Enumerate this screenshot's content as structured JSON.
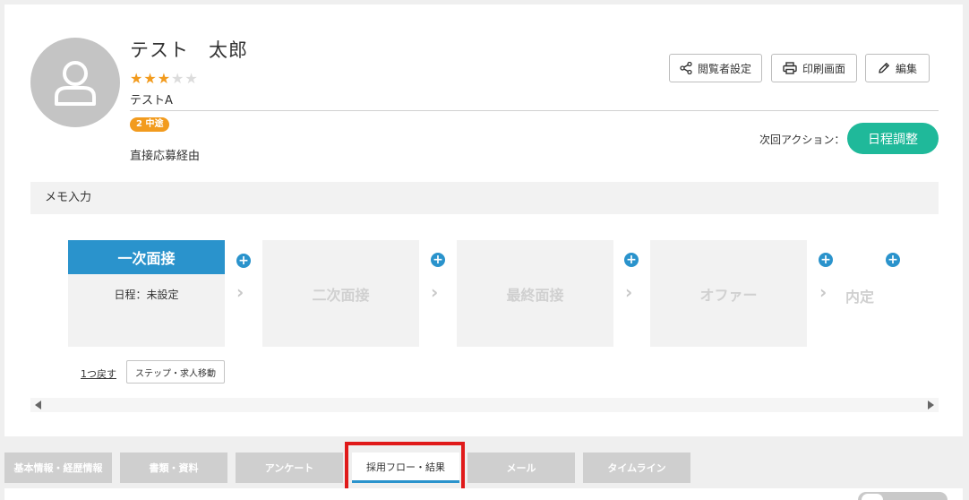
{
  "profile": {
    "name": "テスト　太郎",
    "rating": 3,
    "rating_max": 5,
    "subtitle": "テストA",
    "badge": "2 中途",
    "route": "直接応募経由"
  },
  "header_buttons": {
    "viewer_settings": "閲覧者設定",
    "print": "印刷画面",
    "edit": "編集"
  },
  "next_action": {
    "label": "次回アクション：",
    "button": "日程調整",
    "color": "#1fb99a"
  },
  "memo": {
    "placeholder": "メモ入力"
  },
  "flow": {
    "active_step": {
      "title": "一次面接",
      "schedule": "日程：未設定"
    },
    "steps": [
      "二次面接",
      "最終面接",
      "オファー"
    ],
    "last_step": "内定",
    "back_link": "1つ戻す",
    "move_button": "ステップ・求人移動"
  },
  "tabs": [
    {
      "label": "基本情報・経歴情報"
    },
    {
      "label": "書類・資料"
    },
    {
      "label": "アンケート"
    },
    {
      "label": "採用フロー・結果",
      "active": true
    },
    {
      "label": "メール"
    },
    {
      "label": "タイムライン"
    }
  ],
  "colors": {
    "accent_blue": "#2a93cc",
    "star_orange": "#f29b1e",
    "highlight_red": "#e01a1a"
  }
}
